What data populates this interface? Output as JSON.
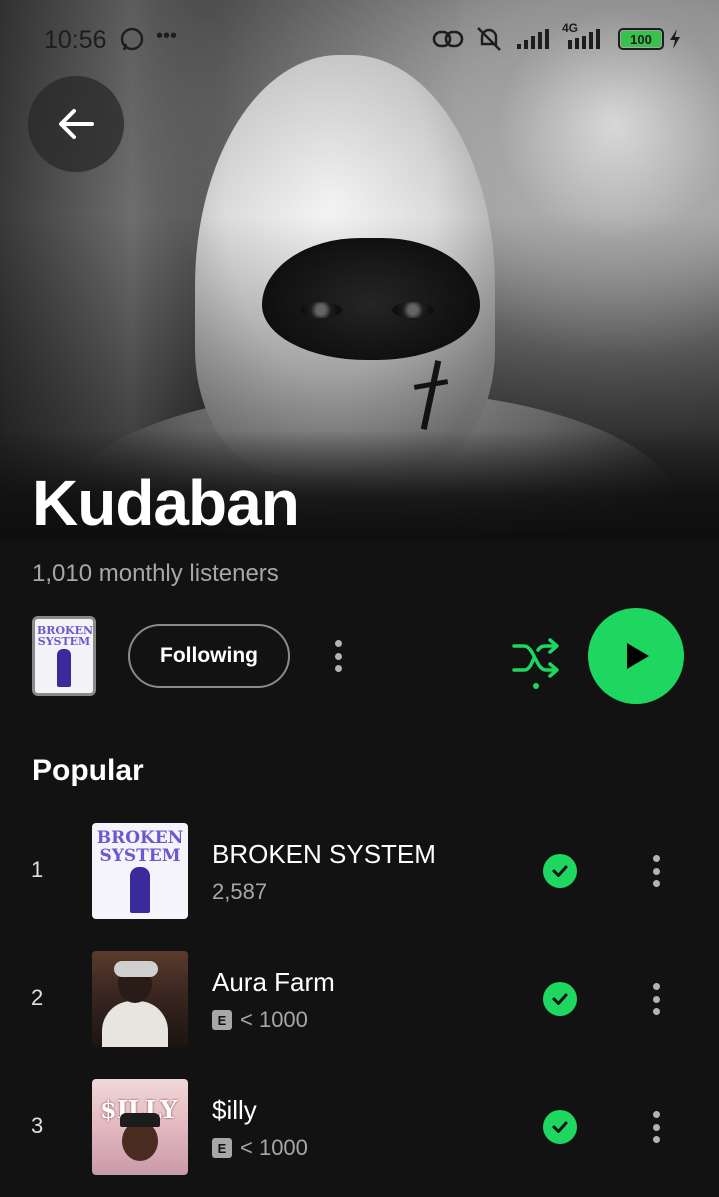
{
  "status_bar": {
    "time": "10:56",
    "network_label": "4G",
    "battery": "100"
  },
  "artist": {
    "name": "Kudaban",
    "monthly_listeners": "1,010 monthly listeners",
    "cover_thumb_text": "BROKEN SYSTEM"
  },
  "actions": {
    "follow_label": "Following"
  },
  "colors": {
    "accent": "#1ed760",
    "background": "#121212",
    "secondary_text": "#a7a7a7"
  },
  "popular": {
    "title": "Popular",
    "tracks": [
      {
        "rank": "1",
        "title": "BROKEN SYSTEM",
        "plays": "2,587",
        "explicit": false,
        "art_text": "BROKEN SYSTEM"
      },
      {
        "rank": "2",
        "title": "Aura Farm",
        "plays": "< 1000",
        "explicit": true,
        "explicit_label": "E"
      },
      {
        "rank": "3",
        "title": "$illy",
        "plays": "< 1000",
        "explicit": true,
        "explicit_label": "E",
        "art_text": "$ILLY"
      }
    ]
  }
}
